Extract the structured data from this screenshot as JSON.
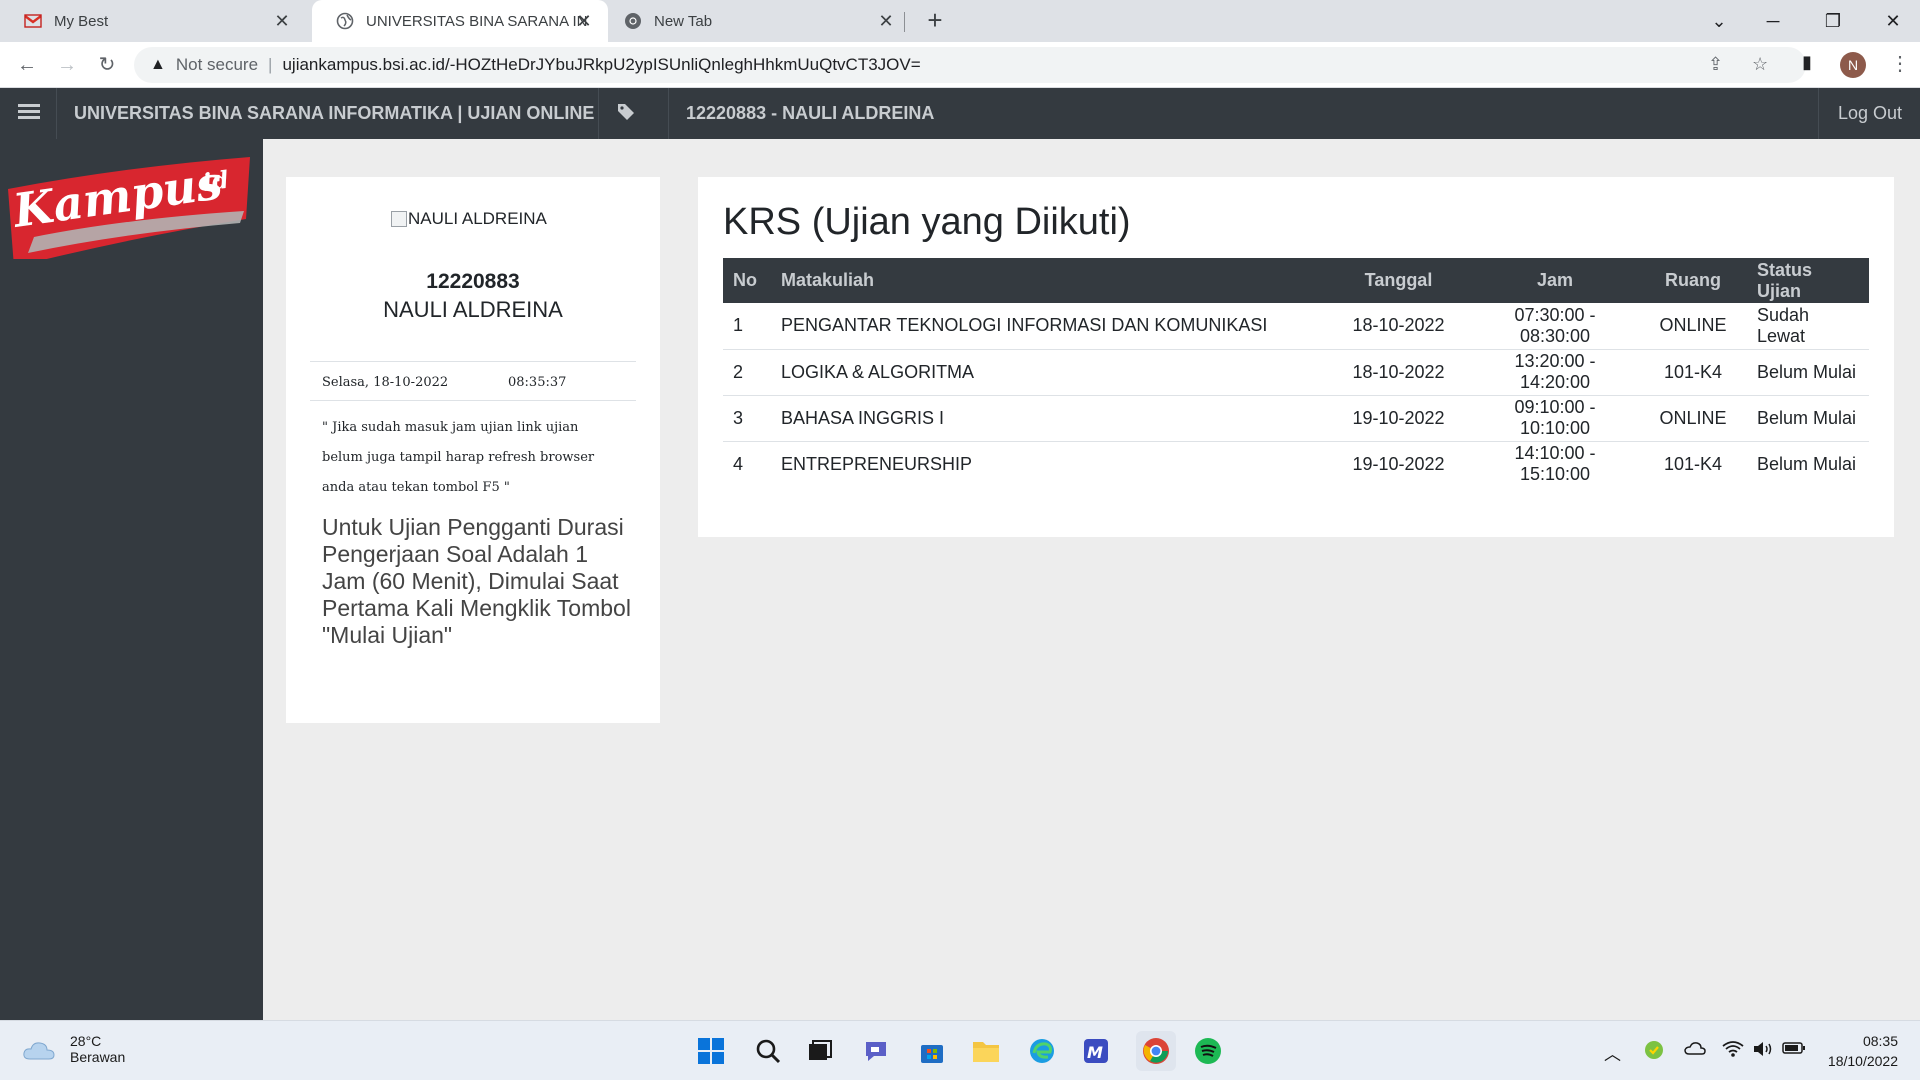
{
  "browser": {
    "tabs": [
      {
        "title": "My Best",
        "active": false
      },
      {
        "title": "UNIVERSITAS BINA SARANA INFO",
        "active": true
      },
      {
        "title": "New Tab",
        "active": false
      }
    ],
    "security_label": "Not secure",
    "url": "ujiankampus.bsi.ac.id/-HOZtHeDrJYbuJRkpU2ypISUnliQnleghHhkmUuQtvCT3JOV=",
    "profile_initial": "N"
  },
  "site_nav": {
    "brand": "UNIVERSITAS BINA SARANA INFORMATIKA | UJIAN ONLINE",
    "user": "12220883 - NAULI ALDREINA",
    "logout": "Log Out"
  },
  "profile": {
    "photo_alt": "NAULI ALDREINA",
    "nim": "12220883",
    "name": "NAULI ALDREINA",
    "date": "Selasa, 18-10-2022",
    "time": "08:35:37",
    "notice": "\" Jika sudah masuk jam ujian link ujian belum juga tampil harap refresh browser anda atau tekan tombol F5 \"",
    "notice2": "Untuk Ujian Pengganti Durasi Pengerjaan Soal Adalah 1 Jam (60 Menit), Dimulai Saat Pertama Kali Mengklik Tombol \"Mulai Ujian\""
  },
  "krs": {
    "title": "KRS (Ujian yang Diikuti)",
    "headers": {
      "no": "No",
      "matakuliah": "Matakuliah",
      "tanggal": "Tanggal",
      "jam": "Jam",
      "ruang": "Ruang",
      "status": "Status Ujian"
    },
    "rows": [
      {
        "no": "1",
        "matakuliah": "PENGANTAR TEKNOLOGI INFORMASI DAN KOMUNIKASI",
        "tanggal": "18-10-2022",
        "jam": "07:30:00 - 08:30:00",
        "ruang": "ONLINE",
        "status": "Sudah Lewat"
      },
      {
        "no": "2",
        "matakuliah": "LOGIKA & ALGORITMA",
        "tanggal": "18-10-2022",
        "jam": "13:20:00 - 14:20:00",
        "ruang": "101-K4",
        "status": "Belum Mulai"
      },
      {
        "no": "3",
        "matakuliah": "BAHASA INGGRIS I",
        "tanggal": "19-10-2022",
        "jam": "09:10:00 - 10:10:00",
        "ruang": "ONLINE",
        "status": "Belum Mulai"
      },
      {
        "no": "4",
        "matakuliah": "ENTREPRENEURSHIP",
        "tanggal": "19-10-2022",
        "jam": "14:10:00 - 15:10:00",
        "ruang": "101-K4",
        "status": "Belum Mulai"
      }
    ]
  },
  "taskbar": {
    "weather_temp": "28°C",
    "weather_desc": "Berawan",
    "time": "08:35",
    "date": "18/10/2022"
  },
  "colors": {
    "nav_bg": "#343a40",
    "nav_text": "#c8ccd0",
    "page_bg": "#ededed",
    "logo_red": "#d8262f"
  }
}
